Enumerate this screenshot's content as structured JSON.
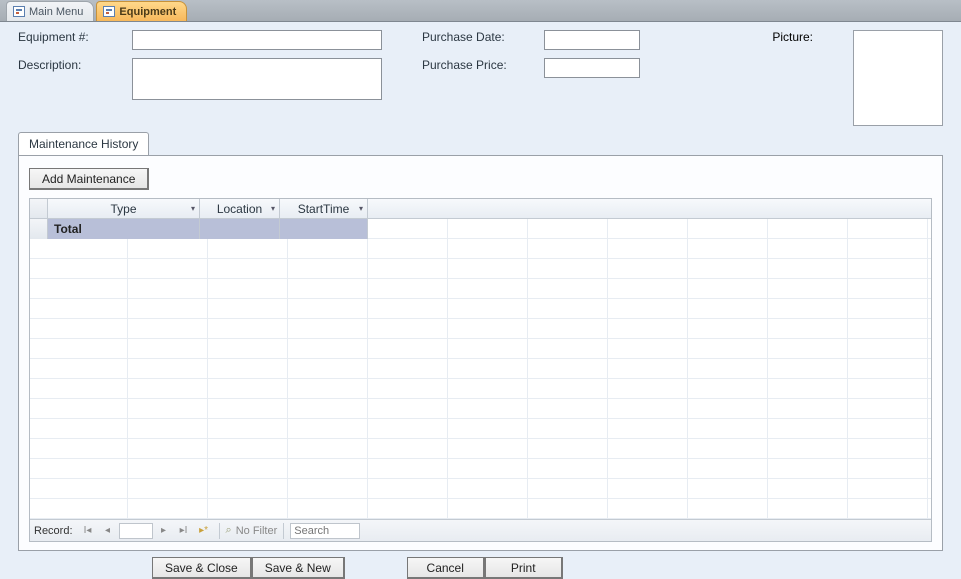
{
  "tabs": {
    "main_menu": "Main Menu",
    "equipment": "Equipment"
  },
  "fields": {
    "equipment_no_label": "Equipment #:",
    "description_label": "Description:",
    "purchase_date_label": "Purchase Date:",
    "purchase_price_label": "Purchase Price:",
    "picture_label": "Picture:",
    "equipment_no_value": "",
    "description_value": "",
    "purchase_date_value": "",
    "purchase_price_value": ""
  },
  "subtab": {
    "maintenance_history": "Maintenance History"
  },
  "buttons": {
    "add_maintenance": "Add Maintenance",
    "save_close": "Save & Close",
    "save_new": "Save & New",
    "cancel": "Cancel",
    "print": "Print"
  },
  "grid": {
    "columns": {
      "type": "Type",
      "location": "Location",
      "starttime": "StartTime"
    },
    "total_label": "Total"
  },
  "nav": {
    "record_label": "Record:",
    "no_filter": "No Filter",
    "search_placeholder": "Search",
    "current": ""
  }
}
